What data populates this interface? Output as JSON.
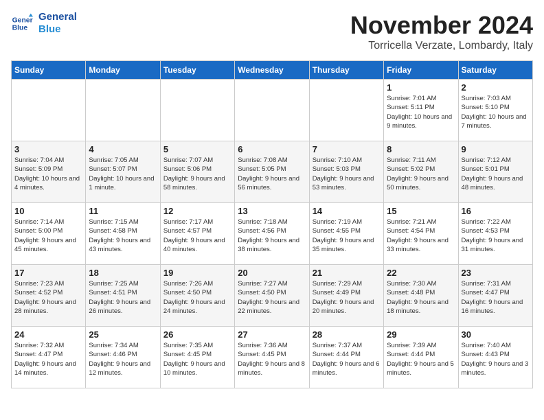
{
  "logo": {
    "line1": "General",
    "line2": "Blue"
  },
  "title": "November 2024",
  "location": "Torricella Verzate, Lombardy, Italy",
  "weekdays": [
    "Sunday",
    "Monday",
    "Tuesday",
    "Wednesday",
    "Thursday",
    "Friday",
    "Saturday"
  ],
  "weeks": [
    [
      {
        "day": "",
        "info": ""
      },
      {
        "day": "",
        "info": ""
      },
      {
        "day": "",
        "info": ""
      },
      {
        "day": "",
        "info": ""
      },
      {
        "day": "",
        "info": ""
      },
      {
        "day": "1",
        "info": "Sunrise: 7:01 AM\nSunset: 5:11 PM\nDaylight: 10 hours and 9 minutes."
      },
      {
        "day": "2",
        "info": "Sunrise: 7:03 AM\nSunset: 5:10 PM\nDaylight: 10 hours and 7 minutes."
      }
    ],
    [
      {
        "day": "3",
        "info": "Sunrise: 7:04 AM\nSunset: 5:09 PM\nDaylight: 10 hours and 4 minutes."
      },
      {
        "day": "4",
        "info": "Sunrise: 7:05 AM\nSunset: 5:07 PM\nDaylight: 10 hours and 1 minute."
      },
      {
        "day": "5",
        "info": "Sunrise: 7:07 AM\nSunset: 5:06 PM\nDaylight: 9 hours and 58 minutes."
      },
      {
        "day": "6",
        "info": "Sunrise: 7:08 AM\nSunset: 5:05 PM\nDaylight: 9 hours and 56 minutes."
      },
      {
        "day": "7",
        "info": "Sunrise: 7:10 AM\nSunset: 5:03 PM\nDaylight: 9 hours and 53 minutes."
      },
      {
        "day": "8",
        "info": "Sunrise: 7:11 AM\nSunset: 5:02 PM\nDaylight: 9 hours and 50 minutes."
      },
      {
        "day": "9",
        "info": "Sunrise: 7:12 AM\nSunset: 5:01 PM\nDaylight: 9 hours and 48 minutes."
      }
    ],
    [
      {
        "day": "10",
        "info": "Sunrise: 7:14 AM\nSunset: 5:00 PM\nDaylight: 9 hours and 45 minutes."
      },
      {
        "day": "11",
        "info": "Sunrise: 7:15 AM\nSunset: 4:58 PM\nDaylight: 9 hours and 43 minutes."
      },
      {
        "day": "12",
        "info": "Sunrise: 7:17 AM\nSunset: 4:57 PM\nDaylight: 9 hours and 40 minutes."
      },
      {
        "day": "13",
        "info": "Sunrise: 7:18 AM\nSunset: 4:56 PM\nDaylight: 9 hours and 38 minutes."
      },
      {
        "day": "14",
        "info": "Sunrise: 7:19 AM\nSunset: 4:55 PM\nDaylight: 9 hours and 35 minutes."
      },
      {
        "day": "15",
        "info": "Sunrise: 7:21 AM\nSunset: 4:54 PM\nDaylight: 9 hours and 33 minutes."
      },
      {
        "day": "16",
        "info": "Sunrise: 7:22 AM\nSunset: 4:53 PM\nDaylight: 9 hours and 31 minutes."
      }
    ],
    [
      {
        "day": "17",
        "info": "Sunrise: 7:23 AM\nSunset: 4:52 PM\nDaylight: 9 hours and 28 minutes."
      },
      {
        "day": "18",
        "info": "Sunrise: 7:25 AM\nSunset: 4:51 PM\nDaylight: 9 hours and 26 minutes."
      },
      {
        "day": "19",
        "info": "Sunrise: 7:26 AM\nSunset: 4:50 PM\nDaylight: 9 hours and 24 minutes."
      },
      {
        "day": "20",
        "info": "Sunrise: 7:27 AM\nSunset: 4:50 PM\nDaylight: 9 hours and 22 minutes."
      },
      {
        "day": "21",
        "info": "Sunrise: 7:29 AM\nSunset: 4:49 PM\nDaylight: 9 hours and 20 minutes."
      },
      {
        "day": "22",
        "info": "Sunrise: 7:30 AM\nSunset: 4:48 PM\nDaylight: 9 hours and 18 minutes."
      },
      {
        "day": "23",
        "info": "Sunrise: 7:31 AM\nSunset: 4:47 PM\nDaylight: 9 hours and 16 minutes."
      }
    ],
    [
      {
        "day": "24",
        "info": "Sunrise: 7:32 AM\nSunset: 4:47 PM\nDaylight: 9 hours and 14 minutes."
      },
      {
        "day": "25",
        "info": "Sunrise: 7:34 AM\nSunset: 4:46 PM\nDaylight: 9 hours and 12 minutes."
      },
      {
        "day": "26",
        "info": "Sunrise: 7:35 AM\nSunset: 4:45 PM\nDaylight: 9 hours and 10 minutes."
      },
      {
        "day": "27",
        "info": "Sunrise: 7:36 AM\nSunset: 4:45 PM\nDaylight: 9 hours and 8 minutes."
      },
      {
        "day": "28",
        "info": "Sunrise: 7:37 AM\nSunset: 4:44 PM\nDaylight: 9 hours and 6 minutes."
      },
      {
        "day": "29",
        "info": "Sunrise: 7:39 AM\nSunset: 4:44 PM\nDaylight: 9 hours and 5 minutes."
      },
      {
        "day": "30",
        "info": "Sunrise: 7:40 AM\nSunset: 4:43 PM\nDaylight: 9 hours and 3 minutes."
      }
    ]
  ]
}
